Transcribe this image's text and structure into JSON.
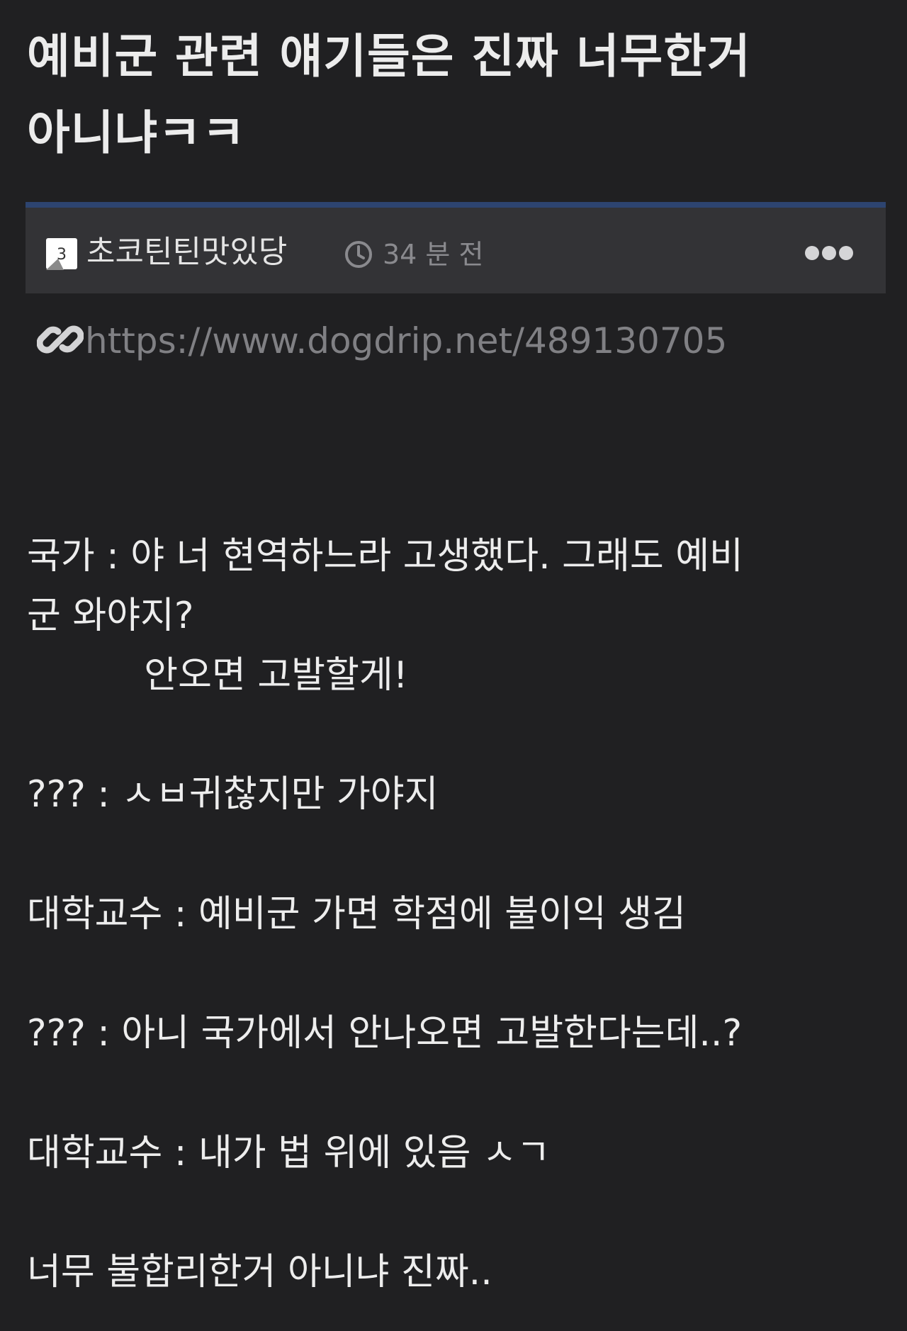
{
  "post": {
    "title_line1": "예비군 관련 얘기들은 진짜 너무한거",
    "title_line2": "아니냐ㅋㅋ",
    "author": "초코틴틴맛있당",
    "level_badge": "3",
    "time_ago": "34 분 전",
    "more_icon": "more-dots-icon",
    "link_url": "https://www.dogdrip.net/489130705"
  },
  "content": {
    "lines": [
      "국가 : 야 너 현역하느라 고생했다. 그래도 예비",
      "군 와야지?",
      "          안오면 고발할게!",
      "??? : ㅅㅂ귀찮지만 가야지",
      "대학교수 : 예비군 가면 학점에 불이익 생김",
      "??? : 아니 국가에서 안나오면 고발한다는데..?",
      "대학교수 : 내가 법 위에 있음 ㅅㄱ",
      "너무 불합리한거 아니냐 진짜.."
    ]
  },
  "colors": {
    "background": "#202022",
    "meta_bar": "#333336",
    "accent_border": "#2d4470",
    "text": "#ededed",
    "muted": "#808084"
  }
}
